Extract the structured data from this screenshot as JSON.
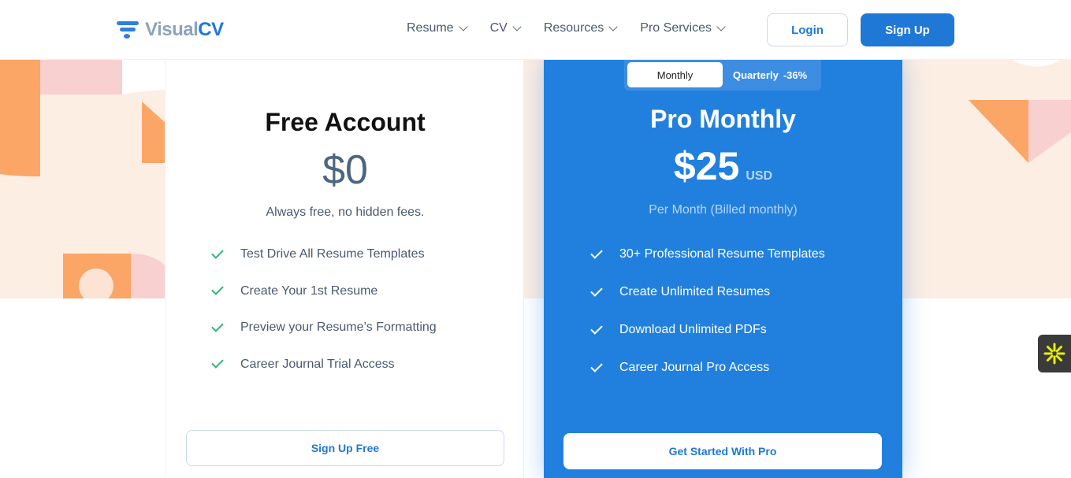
{
  "header": {
    "logo": {
      "visual": "Visual",
      "cv": "CV"
    },
    "nav": [
      {
        "label": "Resume"
      },
      {
        "label": "CV"
      },
      {
        "label": "Resources"
      },
      {
        "label": "Pro Services"
      }
    ],
    "login_label": "Login",
    "signup_label": "Sign Up"
  },
  "free_plan": {
    "title": "Free Account",
    "price": "$0",
    "subtitle": "Always free, no hidden fees.",
    "features": [
      "Test Drive All Resume Templates",
      "Create Your 1st Resume",
      "Preview your Resume’s Formatting",
      "Career Journal Trial Access"
    ],
    "cta": "Sign Up Free"
  },
  "pro_plan": {
    "toggle": {
      "monthly": "Monthly",
      "quarterly": "Quarterly",
      "discount": "-36%",
      "selected": "Monthly"
    },
    "title": "Pro Monthly",
    "price": "$25",
    "currency": "USD",
    "subtitle": "Per Month (Billed monthly)",
    "features": [
      "30+ Professional Resume Templates",
      "Create Unlimited Resumes",
      "Download Unlimited PDFs",
      "Career Journal Pro Access"
    ],
    "cta": "Get Started With Pro"
  },
  "colors": {
    "brand_blue": "#1f77d6",
    "pro_card": "#2180de",
    "check_green": "#2bb673",
    "band_peach": "#fdeee4",
    "shape_orange": "#fba566",
    "shape_pink": "#f8d0cf"
  },
  "widget": {
    "icon": "sunburst-icon"
  }
}
